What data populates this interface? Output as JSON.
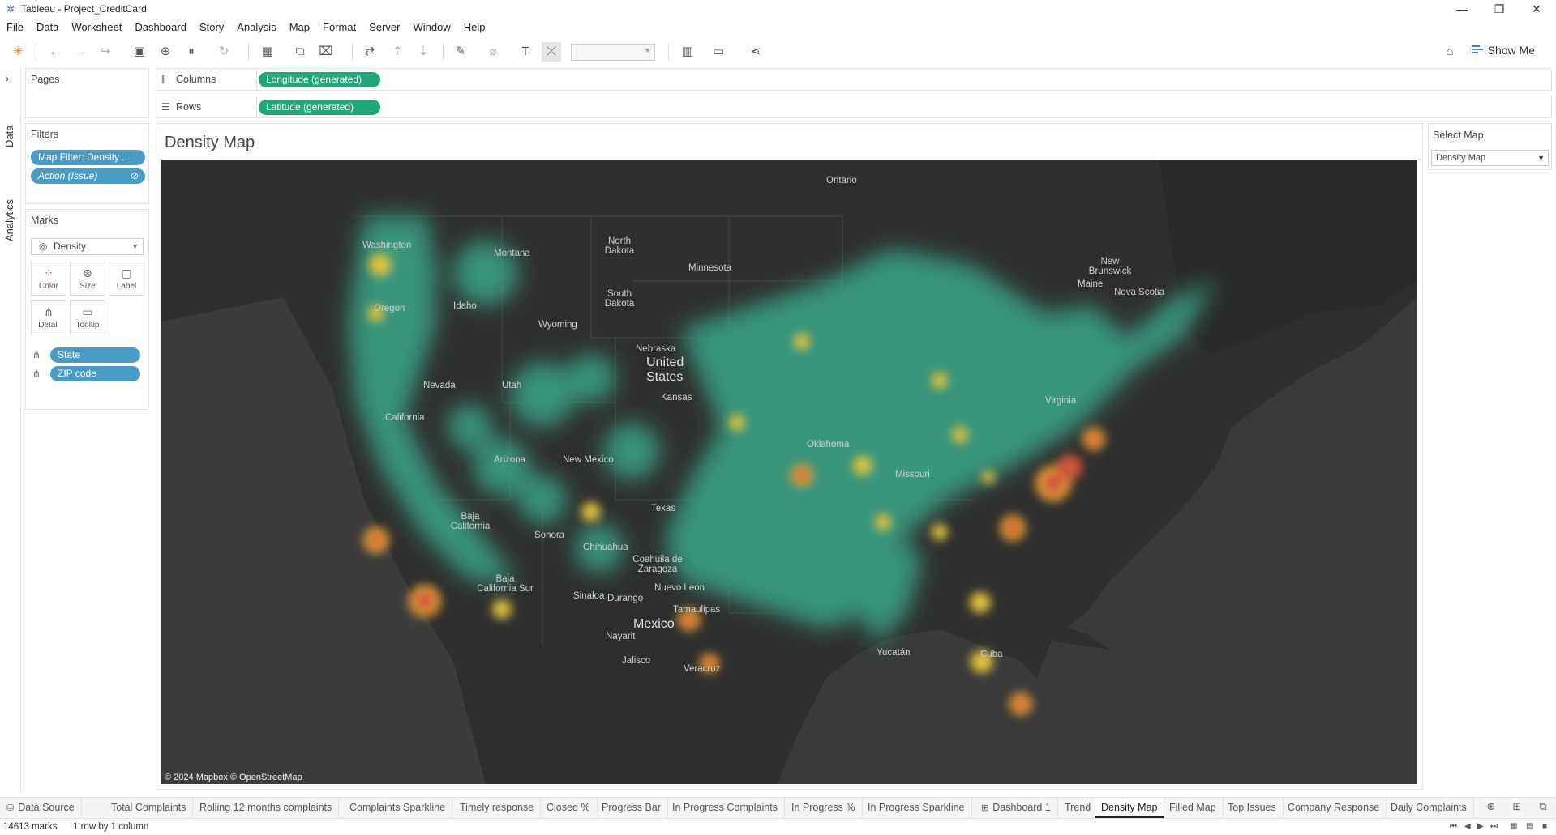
{
  "window": {
    "title": "Tableau - Project_CreditCard",
    "controls": [
      "minimize-icon",
      "maximize-icon",
      "close-icon"
    ]
  },
  "menu": [
    "File",
    "Data",
    "Worksheet",
    "Dashboard",
    "Story",
    "Analysis",
    "Map",
    "Format",
    "Server",
    "Window",
    "Help"
  ],
  "toolbar": {
    "show_me_label": "Show Me"
  },
  "side_tabs": {
    "data": "Data",
    "analytics": "Analytics"
  },
  "panels": {
    "pages_title": "Pages",
    "filters_title": "Filters",
    "filters": [
      "Map Filter: Density ..",
      "Action (Issue)"
    ],
    "marks_title": "Marks",
    "marks_type": "Density",
    "mark_buttons": [
      "Color",
      "Size",
      "Label",
      "Detail",
      "Tooltip"
    ],
    "mark_fields": [
      "State",
      "ZIP code"
    ]
  },
  "shelves": {
    "columns_label": "Columns",
    "columns_pill": "Longitude (generated)",
    "rows_label": "Rows",
    "rows_pill": "Latitude (generated)"
  },
  "view": {
    "title": "Density Map",
    "attribution": "© 2024 Mapbox © OpenStreetMap",
    "labels": [
      "Ontario",
      "New Brunswick",
      "Nova Scotia",
      "Maine",
      "North Dakota",
      "South Dakota",
      "Montana",
      "Idaho",
      "Wyoming",
      "Nebraska",
      "Minnesota",
      "Washington",
      "Oregon",
      "Nevada",
      "Utah",
      "Kansas",
      "Texas",
      "New Mexico",
      "Arizona",
      "California",
      "Missouri",
      "Virginia",
      "Oklahoma",
      "United States",
      "Baja California",
      "Baja California Sur",
      "Sonora",
      "Chihuahua",
      "Coahuila de Zaragoza",
      "Nuevo León",
      "Sinaloa",
      "Durango",
      "Tamaulipas",
      "Nayarit",
      "Jalisco",
      "Veracruz",
      "Yucatán",
      "Cuba",
      "Mexico"
    ]
  },
  "parameter": {
    "title": "Select Map",
    "value": "Density Map"
  },
  "sheet_tabs": {
    "data_source": "Data Source",
    "tabs": [
      "Total Complaints",
      "Rolling 12 months complaints",
      "Complaints Sparkline",
      "Timely response",
      "Closed %",
      "Progress Bar",
      "In Progress Complaints",
      "In Progress %",
      "In Progress Sparkline",
      "Dashboard 1",
      "Trend",
      "Density Map",
      "Filled Map",
      "Top Issues",
      "Company Response",
      "Daily Complaints"
    ],
    "active": "Density Map"
  },
  "status": {
    "marks": "14613 marks",
    "layout": "1 row by 1 column"
  }
}
